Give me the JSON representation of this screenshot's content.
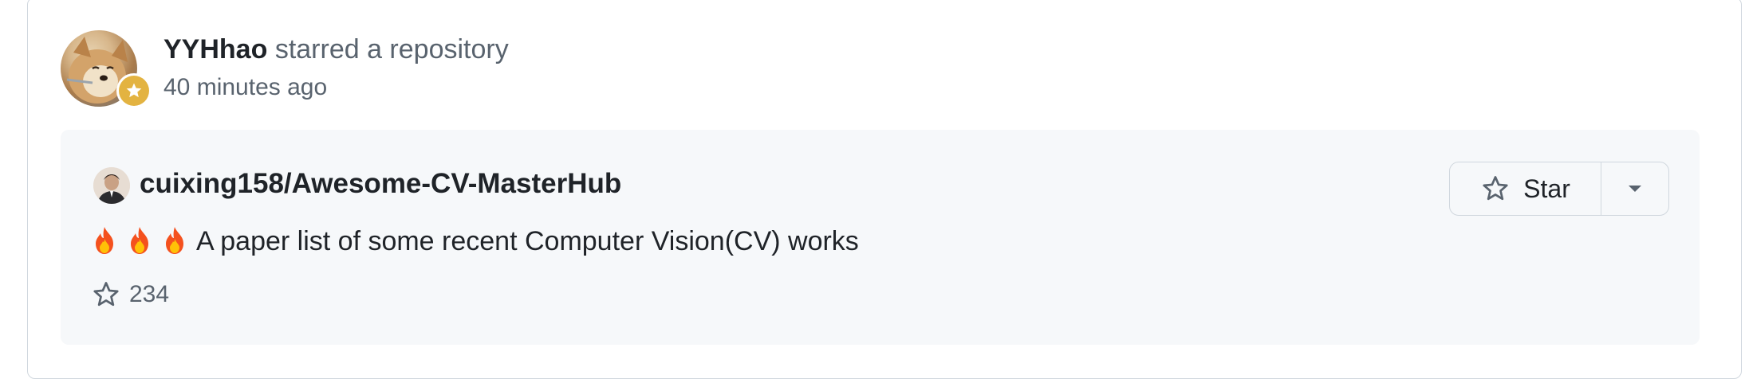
{
  "event": {
    "actor": "YYHhao",
    "action": "starred a repository",
    "time": "40 minutes ago",
    "actor_avatar_icon": "user-avatar",
    "badge_icon": "star-icon",
    "badge_color": "#e3b341"
  },
  "repo": {
    "full_name": "cuixing158/Awesome-CV-MasterHub",
    "owner_avatar_icon": "owner-avatar",
    "description_emoji": [
      "fire-icon",
      "fire-icon",
      "fire-icon"
    ],
    "description": "A paper list of some recent Computer Vision(CV) works",
    "stars": "234",
    "star_button_label": "Star",
    "star_button_icon": "star-outline-icon",
    "dropdown_icon": "triangle-down-icon"
  },
  "colors": {
    "card_border": "#d0d7de",
    "repo_card_bg": "#f6f8fa",
    "muted_text": "#59636e",
    "primary_text": "#1f2328"
  }
}
